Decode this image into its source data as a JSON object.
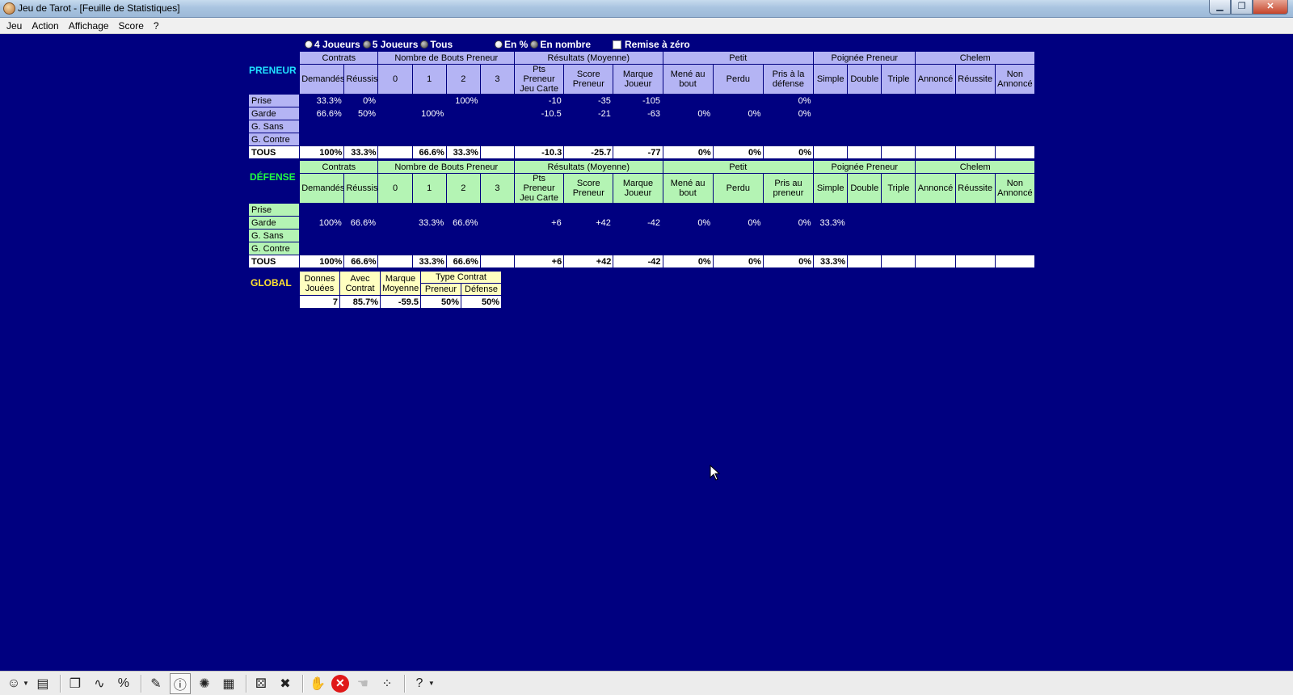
{
  "window": {
    "title": "Jeu de Tarot - [Feuille de Statistiques]",
    "minimize": "0",
    "restore": "1",
    "close": "X"
  },
  "menu": [
    "Jeu",
    "Action",
    "Affichage",
    "Score",
    "?"
  ],
  "options": {
    "players": [
      {
        "label": "4 Joueurs"
      },
      {
        "label": "5 Joueurs"
      },
      {
        "label": "Tous"
      }
    ],
    "mode": [
      {
        "label": "En %"
      },
      {
        "label": "En nombre"
      }
    ],
    "reset": "Remise à zéro"
  },
  "headers": {
    "groups": [
      "Contrats",
      "Nombre de Bouts Preneur",
      "Résultats (Moyenne)",
      "Petit",
      "Poignée Preneur",
      "Chelem"
    ],
    "sub": [
      "Demandés",
      "Réussis",
      "0",
      "1",
      "2",
      "3",
      "Pts Preneur Jeu Carte",
      "Score Preneur",
      "Marque Joueur",
      "Mené au bout",
      "Perdu",
      "Pris à la défense",
      "Simple",
      "Double",
      "Triple",
      "Annoncé",
      "Réussite",
      "Non Annoncé"
    ],
    "sub_defense": [
      "Demandés",
      "Réussis",
      "0",
      "1",
      "2",
      "3",
      "Pts Preneur Jeu Carte",
      "Score Preneur",
      "Marque Joueur",
      "Mené au bout",
      "Perdu",
      "Pris au preneur",
      "Simple",
      "Double",
      "Triple",
      "Annoncé",
      "Réussite",
      "Non Annoncé"
    ]
  },
  "preneur": {
    "label": "PRENEUR",
    "rows": [
      {
        "label": "Prise",
        "cells": [
          "33.3%",
          "0%",
          "",
          "",
          "100%",
          "",
          "-10",
          "-35",
          "-105",
          "",
          "",
          "0%",
          "",
          "",
          "",
          "",
          "",
          ""
        ]
      },
      {
        "label": "Garde",
        "cells": [
          "66.6%",
          "50%",
          "",
          "100%",
          "",
          "",
          "-10.5",
          "-21",
          "-63",
          "0%",
          "0%",
          "0%",
          "",
          "",
          "",
          "",
          "",
          ""
        ]
      },
      {
        "label": "G. Sans",
        "cells": [
          "",
          "",
          "",
          "",
          "",
          "",
          "",
          "",
          "",
          "",
          "",
          "",
          "",
          "",
          "",
          "",
          "",
          ""
        ]
      },
      {
        "label": "G. Contre",
        "cells": [
          "",
          "",
          "",
          "",
          "",
          "",
          "",
          "",
          "",
          "",
          "",
          "",
          "",
          "",
          "",
          "",
          "",
          ""
        ]
      }
    ],
    "total": {
      "label": "TOUS",
      "cells": [
        "100%",
        "33.3%",
        "",
        "66.6%",
        "33.3%",
        "",
        "-10.3",
        "-25.7",
        "-77",
        "0%",
        "0%",
        "0%",
        "",
        "",
        "",
        "",
        "",
        ""
      ]
    }
  },
  "defense": {
    "label": "DÉFENSE",
    "rows": [
      {
        "label": "Prise",
        "cells": [
          "",
          "",
          "",
          "",
          "",
          "",
          "",
          "",
          "",
          "",
          "",
          "",
          "",
          "",
          "",
          "",
          "",
          ""
        ]
      },
      {
        "label": "Garde",
        "cells": [
          "100%",
          "66.6%",
          "",
          "33.3%",
          "66.6%",
          "",
          "+6",
          "+42",
          "-42",
          "0%",
          "0%",
          "0%",
          "33.3%",
          "",
          "",
          "",
          "",
          ""
        ]
      },
      {
        "label": "G. Sans",
        "cells": [
          "",
          "",
          "",
          "",
          "",
          "",
          "",
          "",
          "",
          "",
          "",
          "",
          "",
          "",
          "",
          "",
          "",
          ""
        ]
      },
      {
        "label": "G. Contre",
        "cells": [
          "",
          "",
          "",
          "",
          "",
          "",
          "",
          "",
          "",
          "",
          "",
          "",
          "",
          "",
          "",
          "",
          "",
          ""
        ]
      }
    ],
    "total": {
      "label": "TOUS",
      "cells": [
        "100%",
        "66.6%",
        "",
        "33.3%",
        "66.6%",
        "",
        "+6",
        "+42",
        "-42",
        "0%",
        "0%",
        "0%",
        "33.3%",
        "",
        "",
        "",
        "",
        ""
      ]
    }
  },
  "global": {
    "label": "GLOBAL",
    "headers": [
      "Donnes Jouées",
      "Avec Contrat",
      "Marque Moyenne",
      "Type Contrat",
      "Preneur",
      "Défense"
    ],
    "values": [
      "7",
      "85.7%",
      "-59.5",
      "50%",
      "50%"
    ]
  },
  "toolbar": [
    {
      "name": "player-avatar-icon",
      "glyph": "☺"
    },
    {
      "name": "deck-icon",
      "glyph": "▤"
    },
    {
      "name": "cards-icon",
      "glyph": "❐"
    },
    {
      "name": "graph-icon",
      "glyph": "∿"
    },
    {
      "name": "percent-icon",
      "glyph": "%"
    },
    {
      "name": "score-sheet-icon",
      "glyph": "✎"
    },
    {
      "name": "info-icon",
      "glyph": "ⓘ"
    },
    {
      "name": "hint-bulb-icon",
      "glyph": "✺"
    },
    {
      "name": "calculator-icon",
      "glyph": "▦"
    },
    {
      "name": "dice-icon",
      "glyph": "⚄"
    },
    {
      "name": "delete-sheet-icon",
      "glyph": "✖"
    },
    {
      "name": "hand-icon",
      "glyph": "✋"
    },
    {
      "name": "stop-icon",
      "glyph": "✕"
    },
    {
      "name": "undo-hand-icon",
      "glyph": "☚"
    },
    {
      "name": "players-table-icon",
      "glyph": "⁘"
    },
    {
      "name": "help-icon",
      "glyph": "?"
    }
  ]
}
